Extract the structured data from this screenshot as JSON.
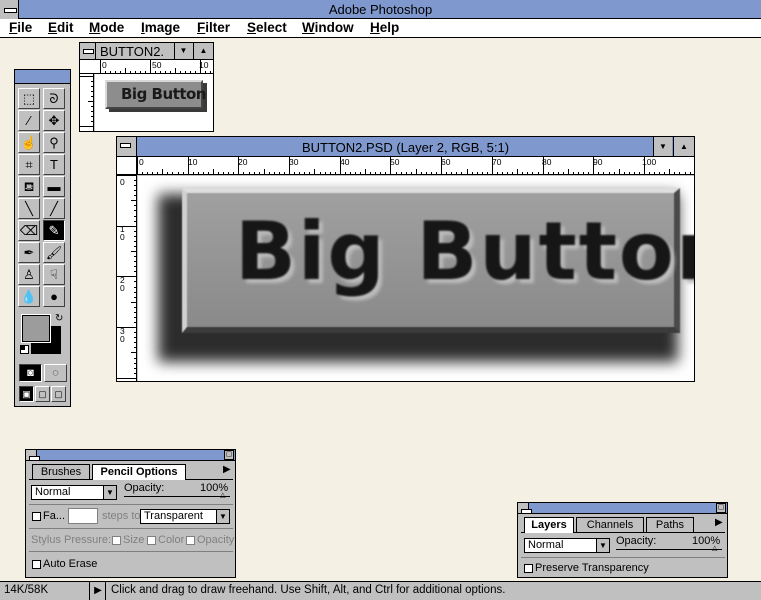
{
  "app": {
    "title": "Adobe Photoshop"
  },
  "menu": [
    "File",
    "Edit",
    "Mode",
    "Image",
    "Filter",
    "Select",
    "Window",
    "Help"
  ],
  "small_window": {
    "title": "BUTTON2.",
    "ruler_labels": [
      "0",
      "50",
      "10"
    ],
    "image_text": "Big Button"
  },
  "main_window": {
    "title": "BUTTON2.PSD  (Layer 2, RGB, 5:1)",
    "h_ruler_labels": [
      "0",
      "10",
      "20",
      "30",
      "40",
      "50",
      "60",
      "70",
      "80",
      "90",
      "100"
    ],
    "v_ruler_labels": [
      "0",
      "1\n0",
      "2\n0",
      "3\n0"
    ],
    "image_text": "Big Button"
  },
  "toolbox": {
    "tools": [
      {
        "name": "marquee-tool",
        "glyph": "⬚"
      },
      {
        "name": "lasso-tool",
        "glyph": "ᘐ"
      },
      {
        "name": "magic-wand-tool",
        "glyph": "⁄"
      },
      {
        "name": "move-tool",
        "glyph": "✥"
      },
      {
        "name": "hand-tool",
        "glyph": "☝"
      },
      {
        "name": "zoom-tool",
        "glyph": "⚲"
      },
      {
        "name": "crop-tool",
        "glyph": "⌗"
      },
      {
        "name": "type-tool",
        "glyph": "T"
      },
      {
        "name": "paint-bucket-tool",
        "glyph": "⛾"
      },
      {
        "name": "gradient-tool",
        "glyph": "▬"
      },
      {
        "name": "line-tool",
        "glyph": "╲"
      },
      {
        "name": "eyedropper-tool",
        "glyph": "╱"
      },
      {
        "name": "eraser-tool",
        "glyph": "⌫"
      },
      {
        "name": "pencil-tool",
        "glyph": "✎"
      },
      {
        "name": "airbrush-tool",
        "glyph": "✒"
      },
      {
        "name": "paintbrush-tool",
        "glyph": "🖌"
      },
      {
        "name": "rubber-stamp-tool",
        "glyph": "♙"
      },
      {
        "name": "smudge-tool",
        "glyph": "☟"
      },
      {
        "name": "blur-tool",
        "glyph": "💧"
      },
      {
        "name": "dodge-tool",
        "glyph": "●"
      }
    ],
    "selected_tool": "pencil-tool",
    "foreground_color": "#000000",
    "background_color": "#9c9c9c"
  },
  "pencil_panel": {
    "tabs": [
      "Brushes",
      "Pencil Options"
    ],
    "mode": "Normal",
    "opacity_label": "Opacity:",
    "opacity_value": "100%",
    "fade_label": "Fa...",
    "fade_value": "",
    "steps_to_label": "steps to",
    "steps_to_value": "Transparent",
    "stylus_label": "Stylus Pressure:",
    "stylus_size": "Size",
    "stylus_color": "Color",
    "stylus_opacity": "Opacity",
    "auto_erase": "Auto Erase"
  },
  "layers_panel": {
    "tabs": [
      "Layers",
      "Channels",
      "Paths"
    ],
    "mode": "Normal",
    "opacity_label": "Opacity:",
    "opacity_value": "100%",
    "preserve_label": "Preserve Transparency"
  },
  "status": {
    "doc_size": "14K/58K",
    "hint": "Click and drag to draw freehand.  Use Shift, Alt, and Ctrl for additional options."
  },
  "colors": {
    "title_bar": "#7f98cd",
    "workspace": "#f4f0e4",
    "chrome": "#c0c0c0"
  }
}
